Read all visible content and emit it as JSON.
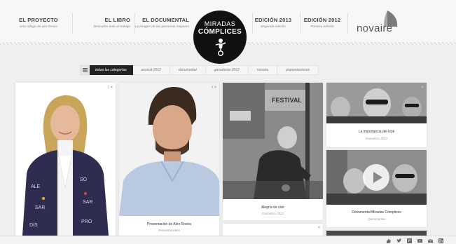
{
  "header": {
    "nav": [
      {
        "title": "EL PROYECTO",
        "subtitle": "Una ráfaga de aire fresco"
      },
      {
        "title": "EL LIBRO",
        "subtitle": "Descubre todo el trabajo"
      },
      {
        "title": "EL DOCUMENTAL",
        "subtitle": "La imagen de las personas mayores"
      },
      {
        "title": "EDICIÓN 2013",
        "subtitle": "Segunda edición"
      },
      {
        "title": "EDICIÓN 2012",
        "subtitle": "Primera edición"
      }
    ],
    "logo": {
      "line1": "MIRADAS",
      "line2": "CÓMPLICES"
    },
    "brand": "novaire"
  },
  "filters": [
    {
      "label": "todas las categorías",
      "active": true
    },
    {
      "label": "accésit 2012",
      "active": false
    },
    {
      "label": "documental",
      "active": false
    },
    {
      "label": "ganadoras 2012",
      "active": false
    },
    {
      "label": "novaire",
      "active": false
    },
    {
      "label": "presentaciones",
      "active": false
    }
  ],
  "cards": [
    {
      "likes": "2",
      "caption": "",
      "category": ""
    },
    {
      "likes": "4",
      "caption": "Presentación de Alex Rovira",
      "category": "Presentaciones"
    },
    {
      "likes": "",
      "caption": "Alegría de vivir",
      "category": "Ganadora 2012"
    },
    {
      "likes": "",
      "caption": "",
      "category": ""
    },
    {
      "likes": "",
      "caption": "La importancia del look",
      "category": "Ganadora 2012"
    },
    {
      "likes": "",
      "caption": "Documental Miradas Cómplices",
      "category": "Documental"
    }
  ],
  "colors": {
    "accent": "#222222",
    "background": "#efefef"
  },
  "icons": [
    "menu-icon",
    "heart-icon",
    "play-icon",
    "facebook-icon",
    "twitter-icon",
    "pinterest-icon",
    "youtube-icon",
    "email-icon",
    "rss-icon"
  ]
}
